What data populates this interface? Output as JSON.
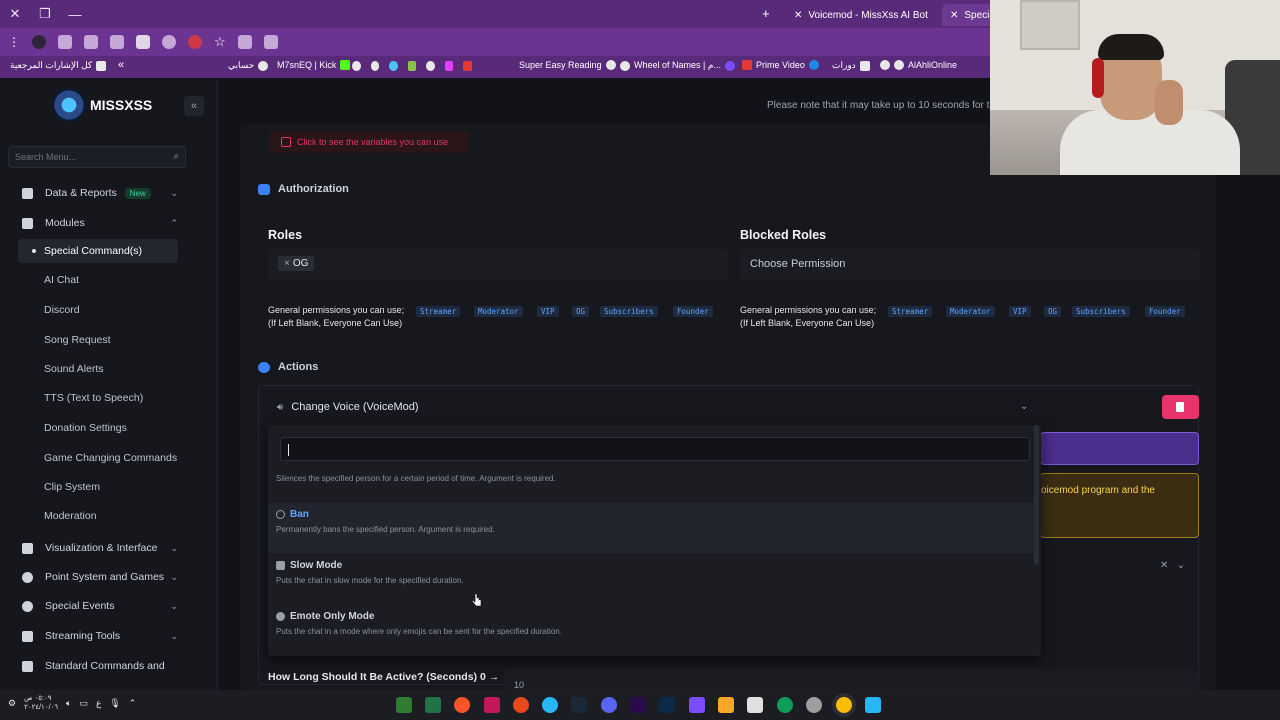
{
  "browser": {
    "tabs": [
      {
        "label": "Voicemod - MissXss AI Bot Syst",
        "active": false
      },
      {
        "label": "Special C",
        "active": true
      }
    ],
    "new_tab": "+",
    "bookmarks": [
      {
        "label": "كل الإشارات المرجعية"
      },
      {
        "label": "حسابي"
      },
      {
        "label": "M7snEQ | Kick"
      },
      {
        "label": "Super Easy Reading"
      },
      {
        "label": "Wheel of Names | م..."
      },
      {
        "label": "Prime Video"
      },
      {
        "label": "دورات"
      },
      {
        "label": "AlAhliOnline"
      }
    ]
  },
  "sidebar": {
    "brand": "MISSXSS",
    "collapse_icon": "«",
    "search_placeholder": "Search Menu...",
    "items": [
      {
        "label": "Data & Reports",
        "badge": "New",
        "chev": "⌄"
      },
      {
        "label": "Modules",
        "chev": "⌃"
      },
      {
        "label": "Visualization & Interface",
        "chev": "⌄"
      },
      {
        "label": "Point System and Games",
        "chev": "⌄"
      },
      {
        "label": "Special Events",
        "chev": "⌄"
      },
      {
        "label": "Streaming Tools",
        "chev": "⌄"
      },
      {
        "label": "Standard Commands and",
        "chev": ""
      }
    ],
    "sub_items": [
      {
        "label": "Special Command(s)"
      },
      {
        "label": "AI Chat"
      },
      {
        "label": "Discord"
      },
      {
        "label": "Song Request"
      },
      {
        "label": "Sound Alerts"
      },
      {
        "label": "TTS (Text to Speech)"
      },
      {
        "label": "Donation Settings"
      },
      {
        "label": "Game Changing Commands"
      },
      {
        "label": "Clip System"
      },
      {
        "label": "Moderation"
      }
    ]
  },
  "header": {
    "note": "Please note that it may take up to 10 seconds for t"
  },
  "main": {
    "variables_button": "Click to see the variables you can use",
    "authorization_title": "Authorization",
    "roles_label": "Roles",
    "roles_chip": "OG",
    "blocked_roles_label": "Blocked Roles",
    "blocked_placeholder": "Choose Permission",
    "perm_line1": "General permissions you can use;",
    "perm_line2": "(If Left Blank, Everyone Can Use)",
    "perm_tags": [
      "Streamer",
      "Moderator",
      "VIP",
      "OG",
      "Subscribers",
      "Founder"
    ],
    "actions_title": "Actions",
    "action_name": "Change Voice (VoiceMod)",
    "warn_text": "oicemod program and the",
    "howlong_label": "How Long Should It Be Active? (Seconds) 0 →",
    "howlong_value": "10"
  },
  "dropdown": {
    "first_desc": "Silences the specified person for a certain period of time. Argument is required.",
    "options": [
      {
        "title": "Ban",
        "desc": "Permanently bans the specified person. Argument is required.",
        "highlighted": true
      },
      {
        "title": "Slow Mode",
        "desc": "Puts the chat in slow mode for the specified duration.",
        "highlighted": false
      },
      {
        "title": "Emote Only Mode",
        "desc": "Puts the chat in a mode where only emojis can be sent for the specified duration.",
        "highlighted": false
      }
    ]
  },
  "taskbar": {
    "time": "٠٥:٠٩ ص",
    "date": "٢٠٢٤/١٠/٠٦",
    "lang": "ع"
  },
  "colors": {
    "accent_blue": "#60a5fa",
    "danger": "#e8336b",
    "browser_purple": "#5a2a7a"
  }
}
